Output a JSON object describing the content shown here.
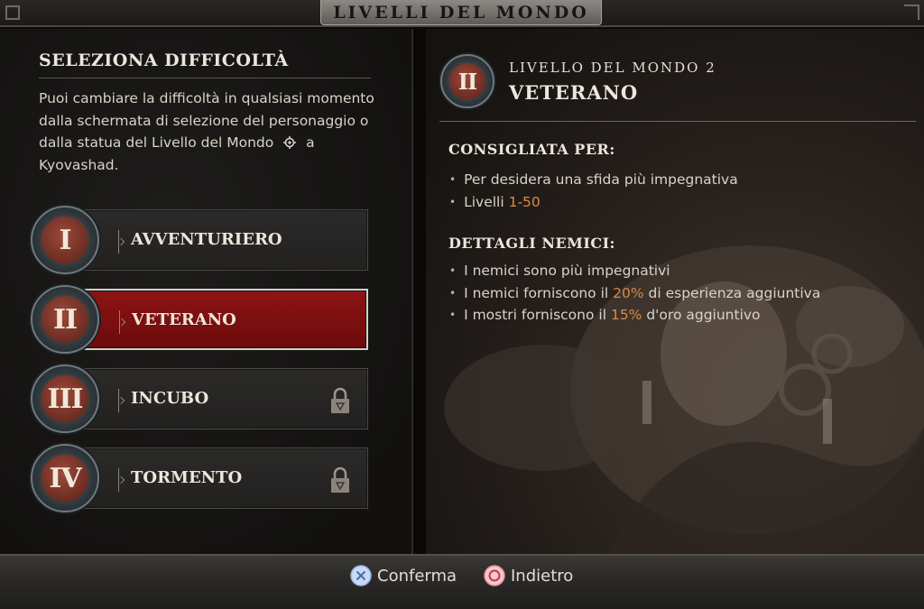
{
  "title": "LIVELLI DEL MONDO",
  "left": {
    "heading": "SELEZIONA DIFFICOLTÀ",
    "description_before_icon": "Puoi cambiare la difficoltà in qualsiasi momento dalla schermata di selezione del personaggio o dalla statua del Livello del Mondo",
    "description_after_icon": "a Kyovashad.",
    "difficulties": [
      {
        "numeral": "I",
        "label": "AVVENTURIERO",
        "selected": false,
        "locked": false
      },
      {
        "numeral": "II",
        "label": "VETERANO",
        "selected": true,
        "locked": false
      },
      {
        "numeral": "III",
        "label": "INCUBO",
        "selected": false,
        "locked": true
      },
      {
        "numeral": "IV",
        "label": "TORMENTO",
        "selected": false,
        "locked": true
      }
    ]
  },
  "right": {
    "numeral": "II",
    "subtitle": "LIVELLO DEL MONDO 2",
    "name": "VETERANO",
    "recommended_heading": "CONSIGLIATA PER:",
    "recommended": [
      {
        "text": "Per desidera una sfida più impegnativa",
        "hl": "",
        "after": ""
      },
      {
        "text": "Livelli ",
        "hl": "1-50",
        "after": ""
      }
    ],
    "enemy_heading": "DETTAGLI NEMICI:",
    "enemy_details": [
      {
        "text": "I nemici sono più impegnativi",
        "hl": "",
        "after": ""
      },
      {
        "text": "I nemici forniscono il ",
        "hl": "20%",
        "after": " di esperienza aggiuntiva"
      },
      {
        "text": "I mostri forniscono il ",
        "hl": "15%",
        "after": " d'oro aggiuntivo"
      }
    ]
  },
  "footer": {
    "confirm": "Conferma",
    "back": "Indietro"
  },
  "colors": {
    "selected_red": "#8e1414",
    "highlight": "#d98b45",
    "cross_button": "#8fb4e6",
    "circle_button": "#e48a98"
  },
  "icons": {
    "world_tier": "world-tier-icon",
    "lock": "lock-icon",
    "cross": "cross-button-icon",
    "circle": "circle-button-icon"
  }
}
